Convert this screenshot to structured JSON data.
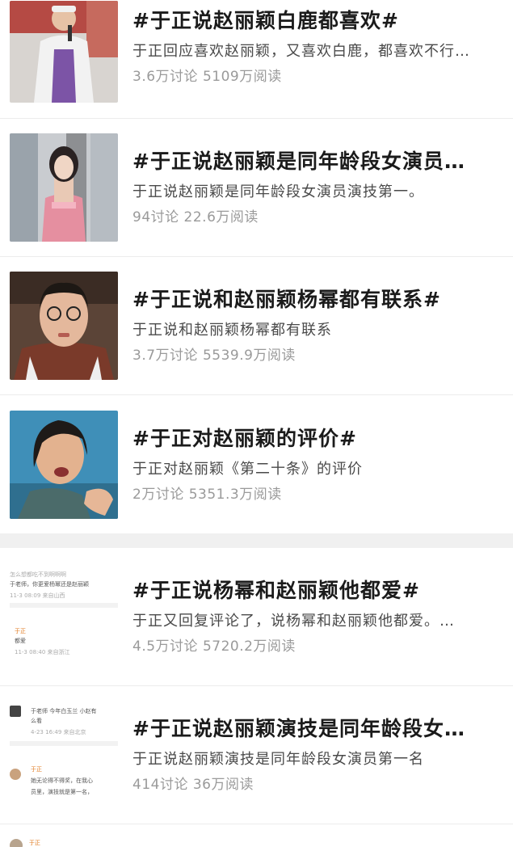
{
  "topics": [
    {
      "title": "#于正说赵丽颖白鹿都喜欢#",
      "desc": "于正回应喜欢赵丽颖，又喜欢白鹿，都喜欢不行…",
      "stats": "3.6万讨论 5109万阅读"
    },
    {
      "title": "#于正说赵丽颖是同年龄段女演员…",
      "desc": "于正说赵丽颖是同年龄段女演员演技第一。",
      "stats": "94讨论 22.6万阅读"
    },
    {
      "title": "#于正说和赵丽颖杨幂都有联系#",
      "desc": "于正说和赵丽颖杨幂都有联系",
      "stats": "3.7万讨论 5539.9万阅读"
    },
    {
      "title": "#于正对赵丽颖的评价#",
      "desc": "于正对赵丽颖《第二十条》的评价",
      "stats": "2万讨论 5351.3万阅读"
    },
    {
      "title": "#于正说杨幂和赵丽颖他都爱#",
      "desc": "于正又回复评论了，说杨幂和赵丽颖他都爱。…",
      "stats": "4.5万讨论 5720.2万阅读"
    },
    {
      "title": "#于正说赵丽颖演技是同年龄段女…",
      "desc": "于正说赵丽颖演技是同年龄段女演员第一名",
      "stats": "414讨论 36万阅读"
    }
  ],
  "thumb5": {
    "q_line": "怎么想都吃不到啊啊啊",
    "q_text": "于老师，你更爱杨幂还是赵丽颖",
    "q_meta": "11-3 08:09 来自山西",
    "a_user": "于正",
    "a_text": "都爱",
    "a_meta": "11-3 08:40 来自浙江"
  },
  "thumb6": {
    "q_text": "于老师 今年白玉兰 小赵有",
    "q_text2": "么看",
    "q_meta": "4-23 16:49 来自北京",
    "a_user": "于正",
    "a_text": "她无论得不得奖，在我心",
    "a_text2": "员里，演技就是第一名，"
  },
  "bottom": {
    "user": "于正"
  }
}
